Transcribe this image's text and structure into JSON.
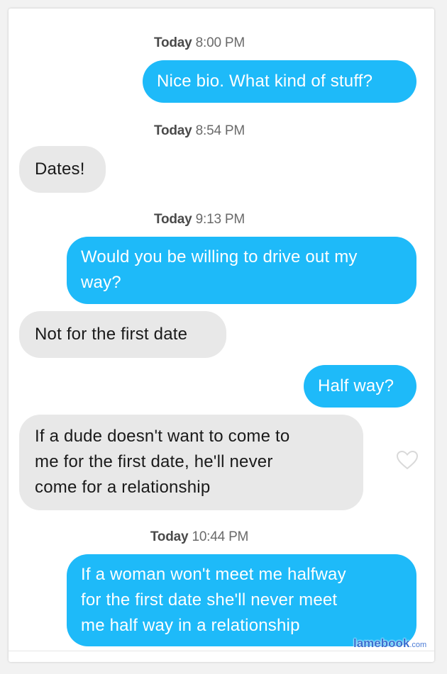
{
  "messages": [
    {
      "type": "timestamp",
      "day": "Today",
      "time": "8:00 PM"
    },
    {
      "type": "outgoing",
      "text": "Nice bio. What kind of stuff?"
    },
    {
      "type": "timestamp",
      "day": "Today",
      "time": "8:54 PM"
    },
    {
      "type": "incoming",
      "text": "Dates!"
    },
    {
      "type": "timestamp",
      "day": "Today",
      "time": "9:13 PM"
    },
    {
      "type": "outgoing",
      "lines": [
        "Would you be willing to drive out my",
        "way?"
      ]
    },
    {
      "type": "incoming",
      "text": "Not for the first date"
    },
    {
      "type": "outgoing",
      "text": "Half way?"
    },
    {
      "type": "incoming",
      "lines": [
        "If a dude doesn't want to come to",
        "me for the first date, he'll never",
        "come for a relationship"
      ]
    },
    {
      "type": "timestamp",
      "day": "Today",
      "time": "10:44 PM"
    },
    {
      "type": "outgoing",
      "lines": [
        "If a woman won't meet me halfway",
        "for the first date she'll never meet",
        "me half way in a relationship"
      ]
    }
  ],
  "like_icon": "heart-outline-icon",
  "watermark": {
    "name": "lamebook",
    "tld": ".com"
  },
  "colors": {
    "outgoing": "#1ebaf9",
    "incoming": "#e8e8e8",
    "background": "#ffffff"
  }
}
